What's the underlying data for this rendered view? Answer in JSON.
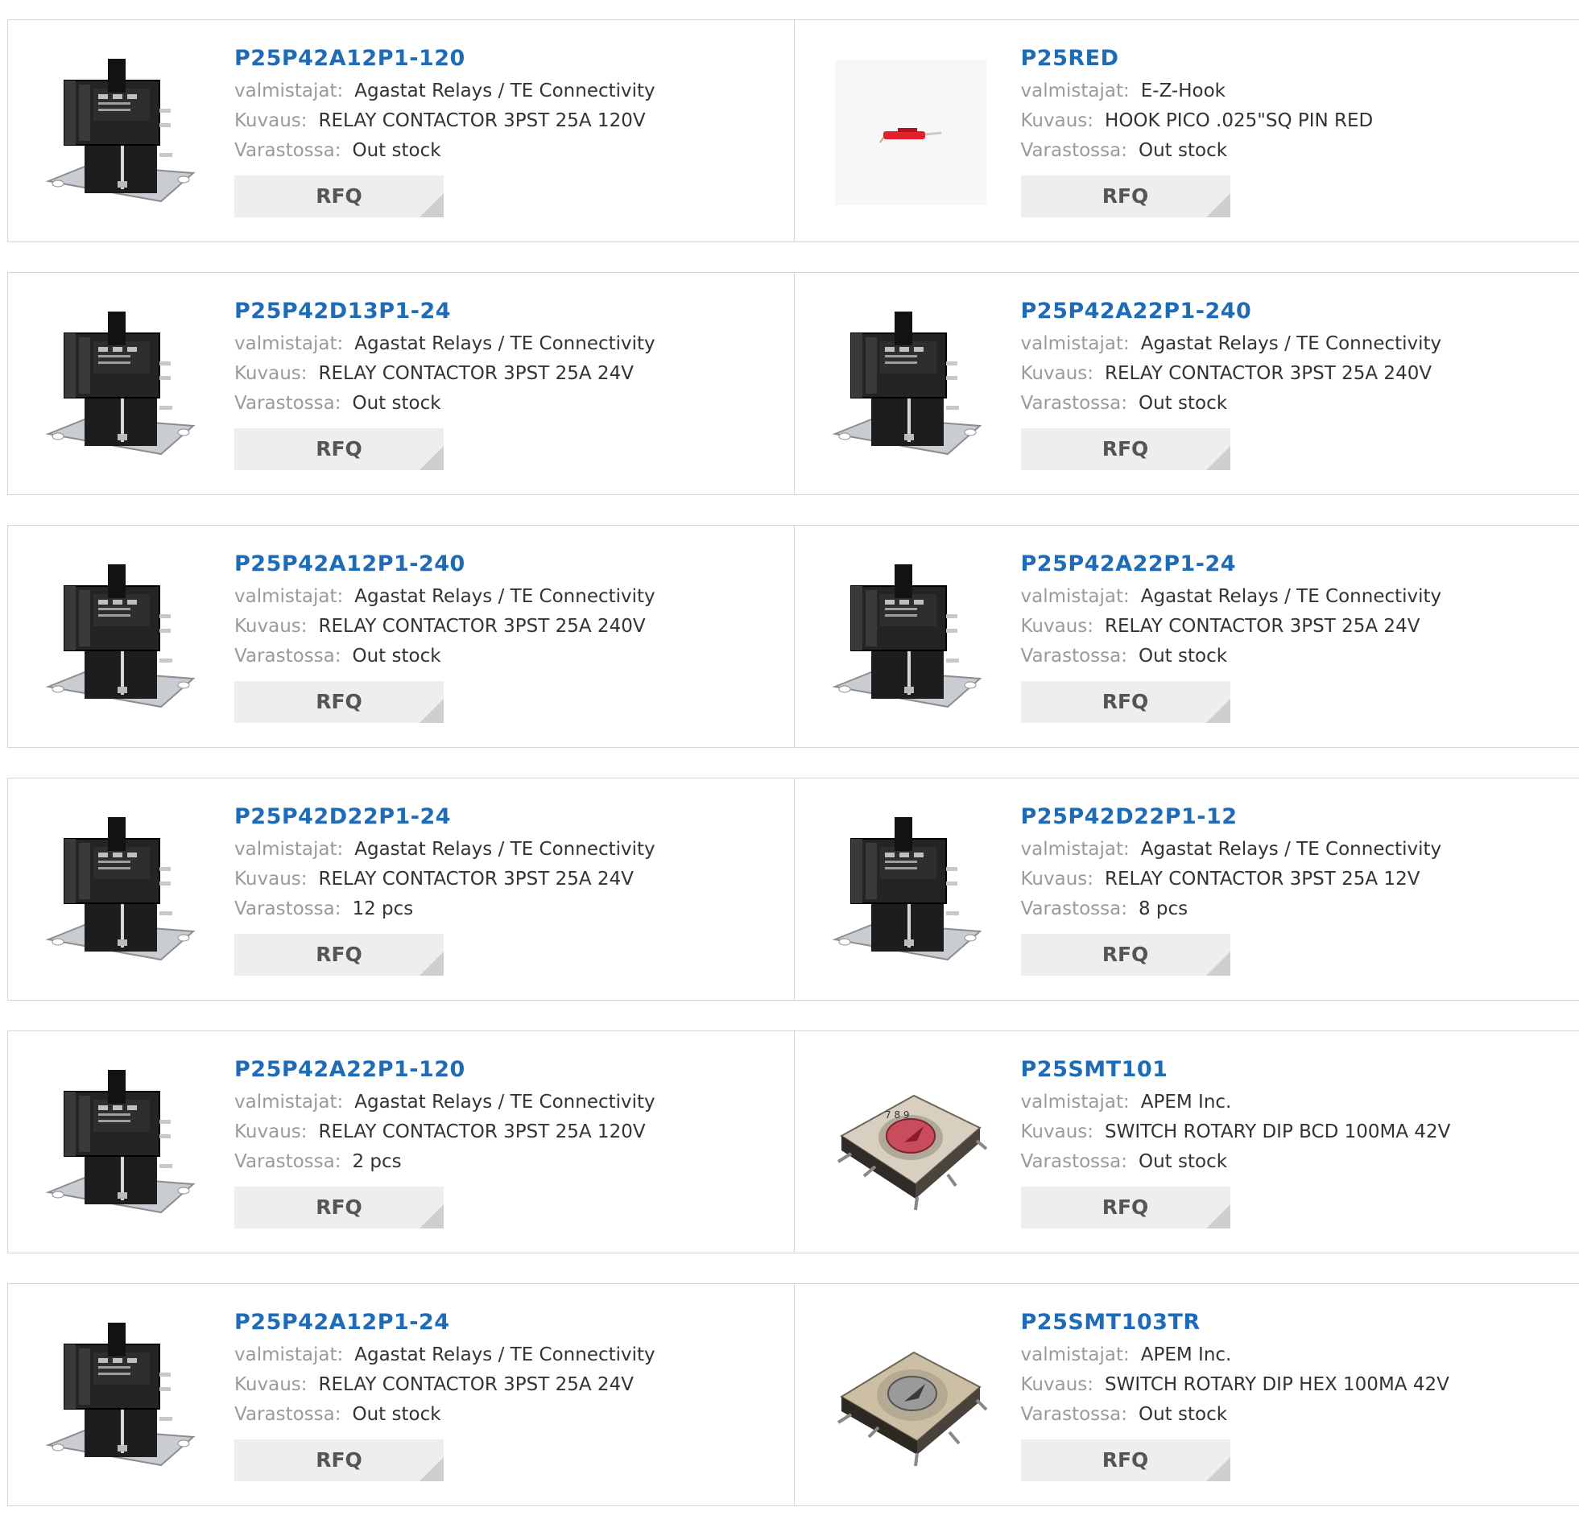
{
  "labels": {
    "manufacturer": "valmistajat:",
    "description": "Kuvaus:",
    "stock": "Varastossa:",
    "rfq": "RFQ"
  },
  "products": [
    {
      "part": "P25P42A12P1-120",
      "manufacturer": "Agastat Relays / TE Connectivity",
      "description": "RELAY CONTACTOR 3PST 25A 120V",
      "stock": "Out stock",
      "image": "relay-contactor"
    },
    {
      "part": "P25RED",
      "manufacturer": "E-Z-Hook",
      "description": "HOOK PICO .025\"SQ PIN RED",
      "stock": "Out stock",
      "image": "red-pin-hook"
    },
    {
      "part": "P25P42D13P1-24",
      "manufacturer": "Agastat Relays / TE Connectivity",
      "description": "RELAY CONTACTOR 3PST 25A 24V",
      "stock": "Out stock",
      "image": "relay-contactor"
    },
    {
      "part": "P25P42A22P1-240",
      "manufacturer": "Agastat Relays / TE Connectivity",
      "description": "RELAY CONTACTOR 3PST 25A 240V",
      "stock": "Out stock",
      "image": "relay-contactor"
    },
    {
      "part": "P25P42A12P1-240",
      "manufacturer": "Agastat Relays / TE Connectivity",
      "description": "RELAY CONTACTOR 3PST 25A 240V",
      "stock": "Out stock",
      "image": "relay-contactor"
    },
    {
      "part": "P25P42A22P1-24",
      "manufacturer": "Agastat Relays / TE Connectivity",
      "description": "RELAY CONTACTOR 3PST 25A 24V",
      "stock": "Out stock",
      "image": "relay-contactor"
    },
    {
      "part": "P25P42D22P1-24",
      "manufacturer": "Agastat Relays / TE Connectivity",
      "description": "RELAY CONTACTOR 3PST 25A 24V",
      "stock": "12 pcs",
      "image": "relay-contactor"
    },
    {
      "part": "P25P42D22P1-12",
      "manufacturer": "Agastat Relays / TE Connectivity",
      "description": "RELAY CONTACTOR 3PST 25A 12V",
      "stock": "8 pcs",
      "image": "relay-contactor"
    },
    {
      "part": "P25P42A22P1-120",
      "manufacturer": "Agastat Relays / TE Connectivity",
      "description": "RELAY CONTACTOR 3PST 25A 120V",
      "stock": "2 pcs",
      "image": "relay-contactor"
    },
    {
      "part": "P25SMT101",
      "manufacturer": "APEM Inc.",
      "description": "SWITCH ROTARY DIP BCD 100MA 42V",
      "stock": "Out stock",
      "image": "rotary-switch-red"
    },
    {
      "part": "P25P42A12P1-24",
      "manufacturer": "Agastat Relays / TE Connectivity",
      "description": "RELAY CONTACTOR 3PST 25A 24V",
      "stock": "Out stock",
      "image": "relay-contactor"
    },
    {
      "part": "P25SMT103TR",
      "manufacturer": "APEM Inc.",
      "description": "SWITCH ROTARY DIP HEX 100MA 42V",
      "stock": "Out stock",
      "image": "rotary-switch-grey"
    }
  ],
  "colors": {
    "part_link": "#1f6bb5",
    "label": "#9a9a9a",
    "value": "#333333",
    "button_bg": "#eeeeee",
    "border": "#d6d6d6"
  }
}
